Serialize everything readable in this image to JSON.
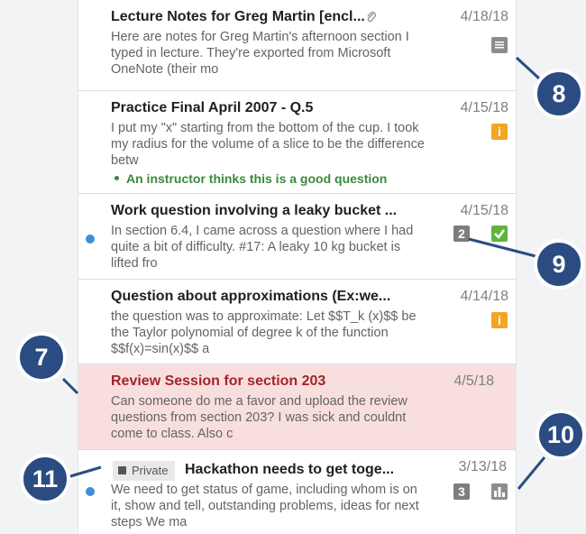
{
  "colors": {
    "accent_dark_blue": "#2a4c82",
    "unread_dot": "#3f8fd4",
    "instructor_green": "#3a8a3a",
    "highlight_pink": "#f9dede",
    "title_red": "#a1262a",
    "question_icon_orange": "#f2a622"
  },
  "posts": [
    {
      "title": "Lecture Notes for Greg Martin [encl...",
      "snippet": "Here are notes for Greg Martin's afternoon section I typed in lecture. They're exported from Microsoft OneNote (their mo",
      "date": "4/18/18",
      "icons": [
        "paperclip-icon",
        "note-icon"
      ]
    },
    {
      "title": "Practice Final April 2007 - Q.5",
      "snippet": "I put my \"x\" starting from the bottom of the cup. I took my radius for the volume of a slice to be the difference betw",
      "endorsement": "An instructor thinks this is a good question",
      "date": "4/15/18",
      "icons": [
        "question-icon"
      ]
    },
    {
      "title": "Work question involving a leaky bucket ...",
      "snippet": "In section 6.4, I came across a question where I had quite a bit of difficulty. #17: A leaky 10 kg bucket is lifted fro",
      "date": "4/15/18",
      "unread": true,
      "count": "2",
      "icons": [
        "resolved-check-icon"
      ]
    },
    {
      "title": "Question about approximations (Ex:we...",
      "snippet": "the question was to approximate: Let $$T_k (x)$$ be the Taylor polynomial of degree k of the function $$f(x)=sin(x)$$ a",
      "date": "4/14/18",
      "icons": [
        "question-icon"
      ]
    },
    {
      "title": "Review Session for section 203",
      "snippet": "Can someone do me a favor and upload the review questions from section 203? I was sick and couldnt come to class. Also c",
      "date": "4/5/18",
      "highlighted": true
    },
    {
      "private_label": "Private",
      "title": "Hackathon needs to get toge...",
      "snippet": "We need to get status of game, including whom is on it, show and tell, outstanding problems, ideas for next steps We ma",
      "date": "3/13/18",
      "unread": true,
      "count": "3",
      "icons": [
        "poll-icon"
      ]
    }
  ],
  "callouts": [
    "8",
    "9",
    "7",
    "10",
    "11"
  ],
  "glyphs": {
    "question_mark": "i",
    "paperclip": "🖇"
  }
}
